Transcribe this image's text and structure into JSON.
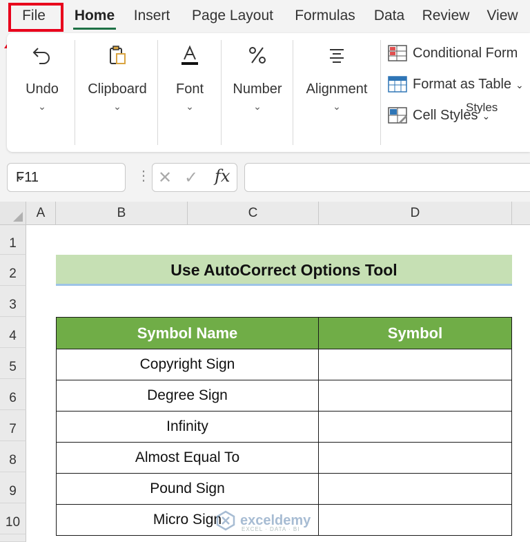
{
  "ribbon_tabs": [
    "File",
    "Home",
    "Insert",
    "Page Layout",
    "Formulas",
    "Data",
    "Review",
    "View"
  ],
  "active_tab": "Home",
  "ribbon_groups": {
    "undo": "Undo",
    "clipboard": "Clipboard",
    "font": "Font",
    "number": "Number",
    "alignment": "Alignment"
  },
  "styles_group": {
    "conditional_formatting": "Conditional Form",
    "format_as_table": "Format as Table",
    "cell_styles": "Cell Styles",
    "label": "Styles"
  },
  "formula_bar": {
    "name_box": "F11",
    "fx_label": "fx",
    "formula": ""
  },
  "columns": [
    "A",
    "B",
    "C",
    "D"
  ],
  "rows": [
    "1",
    "2",
    "3",
    "4",
    "5",
    "6",
    "7",
    "8",
    "9",
    "10"
  ],
  "sheet": {
    "title": "Use AutoCorrect Options Tool",
    "headers": [
      "Symbol Name",
      "Symbol"
    ],
    "items": [
      {
        "name": "Copyright Sign",
        "symbol": ""
      },
      {
        "name": "Degree Sign",
        "symbol": ""
      },
      {
        "name": "Infinity",
        "symbol": ""
      },
      {
        "name": "Almost Equal To",
        "symbol": ""
      },
      {
        "name": "Pound Sign",
        "symbol": ""
      },
      {
        "name": "Micro Sign",
        "symbol": ""
      }
    ]
  },
  "watermark": {
    "name": "exceldemy",
    "sub": "EXCEL · DATA · BI"
  },
  "colors": {
    "accent": "#1e7145",
    "highlight": "#e8001c",
    "header_fill": "#70ad47",
    "title_fill": "#c6e0b4"
  }
}
